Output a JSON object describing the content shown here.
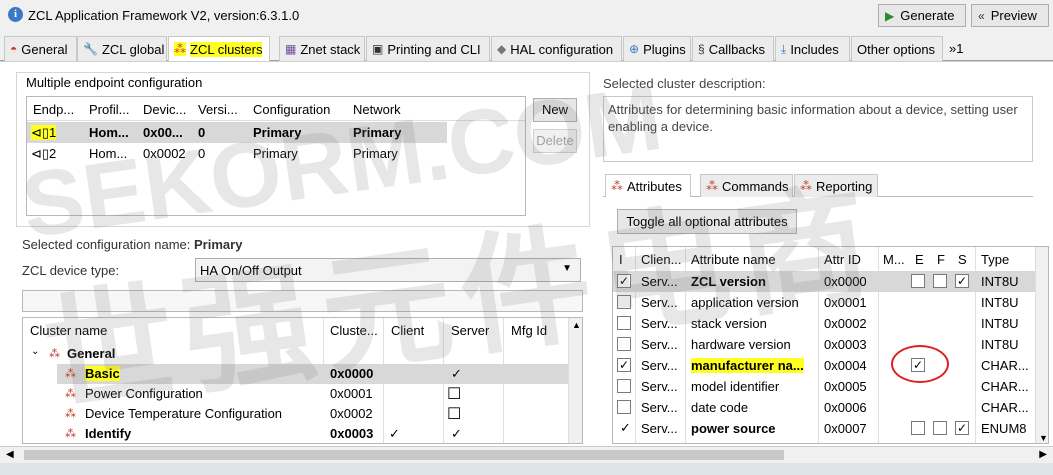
{
  "window": {
    "title": "ZCL Application Framework V2, version:6.3.1.0",
    "generate_label": "Generate",
    "preview_label": "Preview"
  },
  "tabs": [
    {
      "label": "General"
    },
    {
      "label": "ZCL global"
    },
    {
      "label": "ZCL clusters"
    },
    {
      "label": "Znet stack"
    },
    {
      "label": "Printing and CLI"
    },
    {
      "label": "HAL configuration"
    },
    {
      "label": "Plugins"
    },
    {
      "label": "Callbacks"
    },
    {
      "label": "Includes"
    },
    {
      "label": "Other options"
    },
    {
      "label": "»1"
    }
  ],
  "endpoints": {
    "group_title": "Multiple endpoint configuration",
    "columns": [
      "Endp...",
      "Profil...",
      "Devic...",
      "Versi...",
      "Configuration",
      "Network"
    ],
    "rows": [
      {
        "endpoint": "1",
        "profile": "Hom...",
        "device": "0x00...",
        "version": "0",
        "configuration": "Primary",
        "network": "Primary"
      },
      {
        "endpoint": "2",
        "profile": "Hom...",
        "device": "0x0002",
        "version": "0",
        "configuration": "Primary",
        "network": "Primary"
      }
    ],
    "new_label": "New",
    "delete_label": "Delete"
  },
  "config": {
    "selected_label": "Selected configuration name:",
    "selected_value": "Primary",
    "device_type_label": "ZCL device type:",
    "device_type_value": "HA On/Off Output"
  },
  "clusters": {
    "columns": [
      "Cluster name",
      "Cluste...",
      "Client",
      "Server",
      "Mfg Id"
    ],
    "group": "General",
    "rows": [
      {
        "name": "Basic",
        "id": "0x0000",
        "client": "",
        "server": "✓"
      },
      {
        "name": "Power Configuration",
        "id": "0x0001",
        "client": "",
        "server": "☐"
      },
      {
        "name": "Device Temperature Configuration",
        "id": "0x0002",
        "client": "",
        "server": "☐"
      },
      {
        "name": "Identify",
        "id": "0x0003",
        "client": "✓",
        "server": "✓"
      }
    ]
  },
  "description": {
    "label": "Selected cluster description:",
    "text": "Attributes for determining basic information about a device, setting user enabling a device."
  },
  "subtabs": [
    "Attributes",
    "Commands",
    "Reporting"
  ],
  "toggle_label": "Toggle all optional attributes",
  "attributes": {
    "columns": [
      "I",
      "Clien...",
      "Attribute name",
      "Attr ID",
      "M...",
      "E",
      "F",
      "S",
      "Type"
    ],
    "rows": [
      {
        "side": "Serv...",
        "name": "ZCL version",
        "id": "0x0000",
        "type": "INT8U",
        "bold": true
      },
      {
        "side": "Serv...",
        "name": "application version",
        "id": "0x0001",
        "type": "INT8U",
        "bold": false
      },
      {
        "side": "Serv...",
        "name": "stack version",
        "id": "0x0002",
        "type": "INT8U",
        "bold": false
      },
      {
        "side": "Serv...",
        "name": "hardware version",
        "id": "0x0003",
        "type": "INT8U",
        "bold": false
      },
      {
        "side": "Serv...",
        "name": "manufacturer na...",
        "id": "0x0004",
        "type": "CHAR...",
        "bold": true
      },
      {
        "side": "Serv...",
        "name": "model identifier",
        "id": "0x0005",
        "type": "CHAR...",
        "bold": false
      },
      {
        "side": "Serv...",
        "name": "date code",
        "id": "0x0006",
        "type": "CHAR...",
        "bold": false
      },
      {
        "side": "Serv...",
        "name": "power source",
        "id": "0x0007",
        "type": "ENUM8",
        "bold": true
      }
    ]
  },
  "watermark": {
    "line1": "SEKORM.COM",
    "line2": "世强元件电商"
  }
}
